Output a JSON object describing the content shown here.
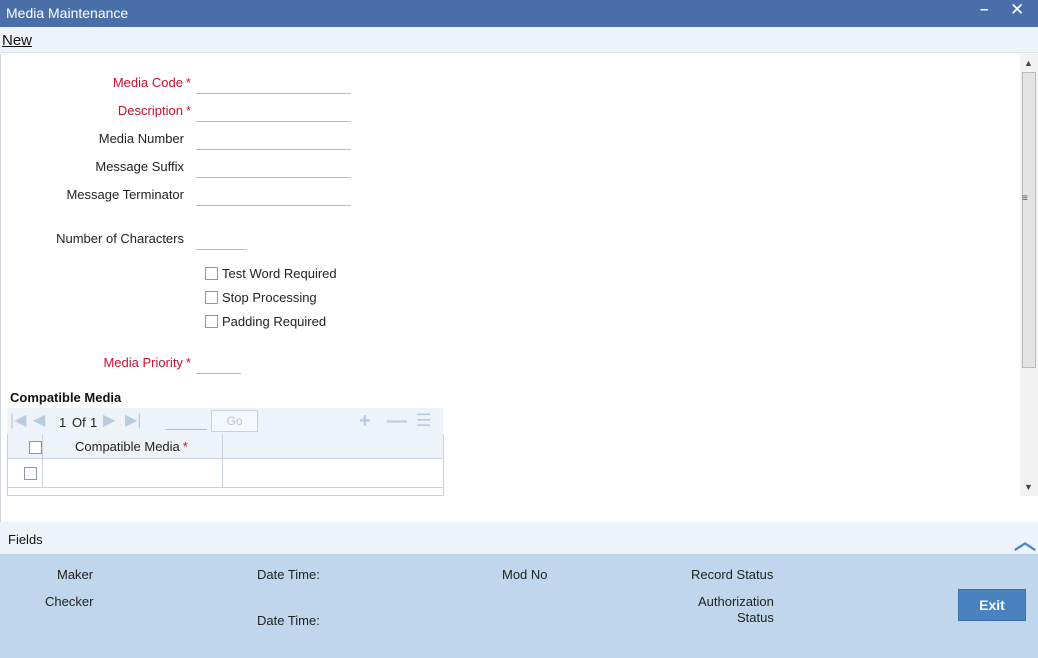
{
  "window": {
    "title": "Media Maintenance",
    "minimize_glyph": "–",
    "close_glyph": "✕"
  },
  "menubar": {
    "new_label": "New"
  },
  "form": {
    "media_code_label": "Media Code",
    "description_label": "Description",
    "media_number_label": "Media Number",
    "message_suffix_label": "Message Suffix",
    "message_terminator_label": "Message Terminator",
    "number_of_characters_label": "Number of Characters",
    "test_word_required_label": "Test Word Required",
    "stop_processing_label": "Stop Processing",
    "padding_required_label": "Padding Required",
    "media_priority_label": "Media Priority",
    "required_marker": "*",
    "values": {
      "media_code": "",
      "description": "",
      "media_number": "",
      "message_suffix": "",
      "message_terminator": "",
      "number_of_characters": "",
      "media_priority": ""
    },
    "checkboxes": {
      "test_word_required": false,
      "stop_processing": false,
      "padding_required": false
    }
  },
  "compatible_media": {
    "section_title": "Compatible Media",
    "pager": {
      "current": "1",
      "of_label": "Of",
      "total": "1"
    },
    "page_input": "",
    "go_label": "Go",
    "column_header": "Compatible Media",
    "rows": [
      {
        "value": ""
      }
    ]
  },
  "fields_bar": {
    "label": "Fields"
  },
  "footer": {
    "maker_label": "Maker",
    "checker_label": "Checker",
    "date_time_label_1": "Date Time:",
    "date_time_label_2": "Date Time:",
    "mod_no_label": "Mod No",
    "record_status_label": "Record Status",
    "authorization_label": "Authorization",
    "status_label": "Status",
    "exit_label": "Exit"
  },
  "icons": {
    "first_page": "first-page-icon",
    "prev_page": "prev-page-icon",
    "next_page": "next-page-icon",
    "last_page": "last-page-icon",
    "add_row": "add-row-icon",
    "delete_row": "delete-row-icon",
    "single_view": "single-view-icon",
    "collapse": "chevron-up-icon"
  },
  "colors": {
    "title_bar": "#4a6fa8",
    "required_label": "#c8102e",
    "footer_background": "#bfd6ec",
    "exit_button": "#4a82bf"
  }
}
